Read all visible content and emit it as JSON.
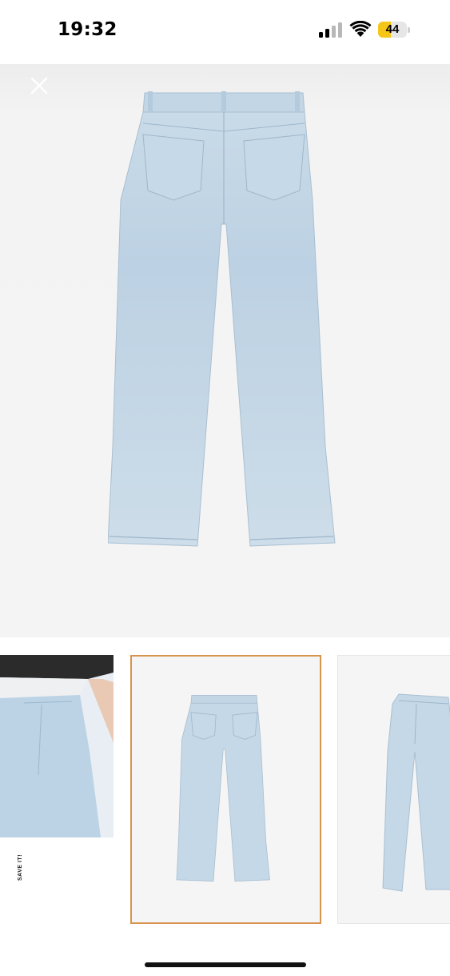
{
  "status_bar": {
    "time": "19:32",
    "battery_level": "44",
    "battery_color": "#f5c518"
  },
  "viewer": {
    "close_icon": "close-icon",
    "main_image": "jeans-back-view"
  },
  "thumbnails": [
    {
      "name": "model-front-view",
      "selected": false,
      "label": "SAVE IT!"
    },
    {
      "name": "jeans-back-view",
      "selected": true,
      "accent": "#d8944f"
    },
    {
      "name": "jeans-front-view",
      "selected": false
    }
  ]
}
